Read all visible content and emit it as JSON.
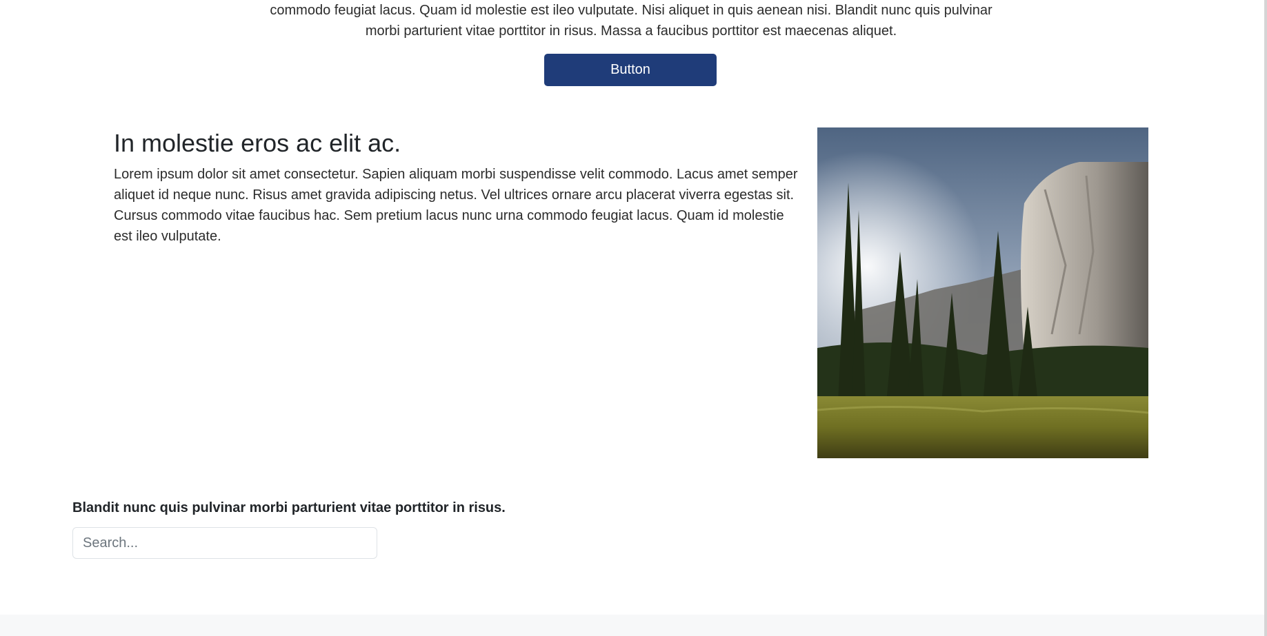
{
  "intro": {
    "line1": "commodo feugiat lacus. Quam id molestie est ileo vulputate. Nisi aliquet in quis aenean nisi. Blandit nunc quis pulvinar",
    "line2": "morbi parturient vitae porttitor in risus. Massa a faucibus porttitor est maecenas aliquet."
  },
  "cta": {
    "button_label": "Button"
  },
  "feature": {
    "heading": "In molestie eros ac elit ac.",
    "body": "Lorem ipsum dolor sit amet consectetur. Sapien aliquam morbi suspendisse velit commodo. Lacus amet semper aliquet id neque nunc. Risus amet gravida adipiscing netus. Vel ultrices ornare arcu placerat viverra egestas sit. Cursus commodo vitae faucibus hac. Sem pretium lacus nunc urna commodo feugiat lacus. Quam id molestie est ileo vulputate."
  },
  "search": {
    "label": "Blandit nunc quis pulvinar morbi parturient vitae porttitor in risus.",
    "placeholder": "Search...",
    "value": ""
  },
  "colors": {
    "primary": "#1f3c79",
    "text": "#212529",
    "footer_bg": "#f7f8f9"
  }
}
